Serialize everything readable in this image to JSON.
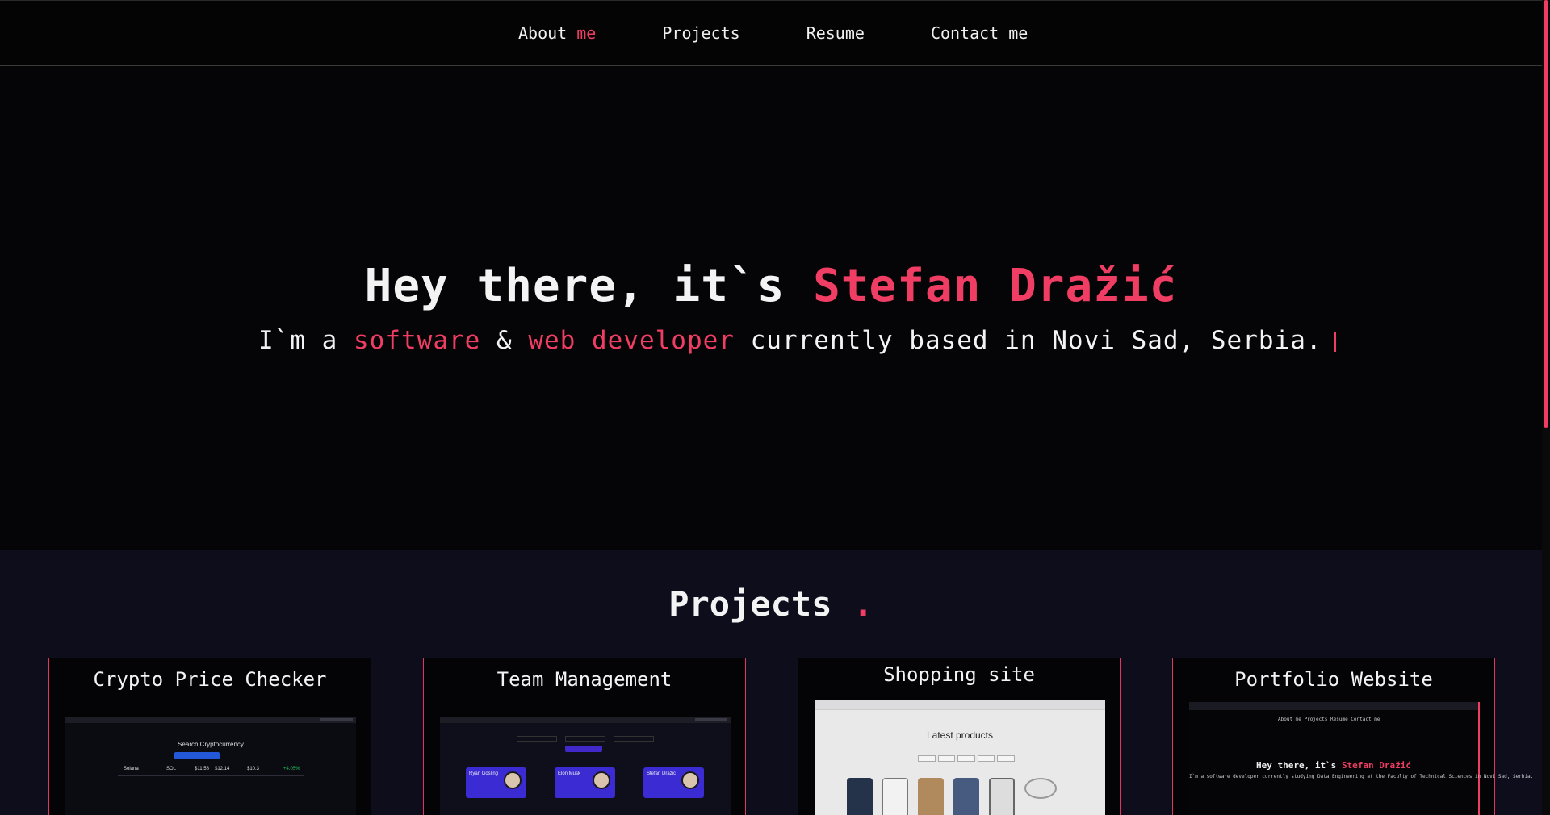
{
  "nav": {
    "items": [
      {
        "label_a": "About",
        "label_b": "me"
      },
      {
        "label_a": "Projects",
        "label_b": ""
      },
      {
        "label_a": "Resume",
        "label_b": ""
      },
      {
        "label_a": "Contact me",
        "label_b": ""
      }
    ]
  },
  "hero": {
    "title_prefix": "Hey there, it`s",
    "title_name": "Stefan Dražić",
    "sub_1": "I`m a",
    "sub_2": "software",
    "sub_3": "&",
    "sub_4": "web developer",
    "sub_5": "currently based in Novi Sad, Serbia."
  },
  "projects": {
    "title": "Projects",
    "dot": ".",
    "cards": [
      {
        "title": "Crypto Price Checker",
        "thumb_heading": "Search Cryptocurrency",
        "row": [
          "Solana",
          "SOL",
          "$11.58",
          "$12.14",
          "$10.3",
          "+4.05%"
        ]
      },
      {
        "title": "Team Management",
        "members": [
          "Ryan Gosling",
          "Elon Musk",
          "Stefan Drazic"
        ]
      },
      {
        "title": "Shopping site",
        "thumb_heading": "Latest products"
      },
      {
        "title": "Portfolio Website",
        "thumb_title_a": "Hey there, it`s",
        "thumb_title_b": "Stefan Dražić",
        "thumb_sub": "I`m a software developer currently studying Data Engineering at the Faculty of Technical Sciences in Novi Sad, Serbia.",
        "thumb_links": "About me    Projects    Resume    Contact me"
      }
    ]
  },
  "colors": {
    "accent": "#ef3d63",
    "background": "#050507",
    "section_bg": "#0d0d1c"
  }
}
